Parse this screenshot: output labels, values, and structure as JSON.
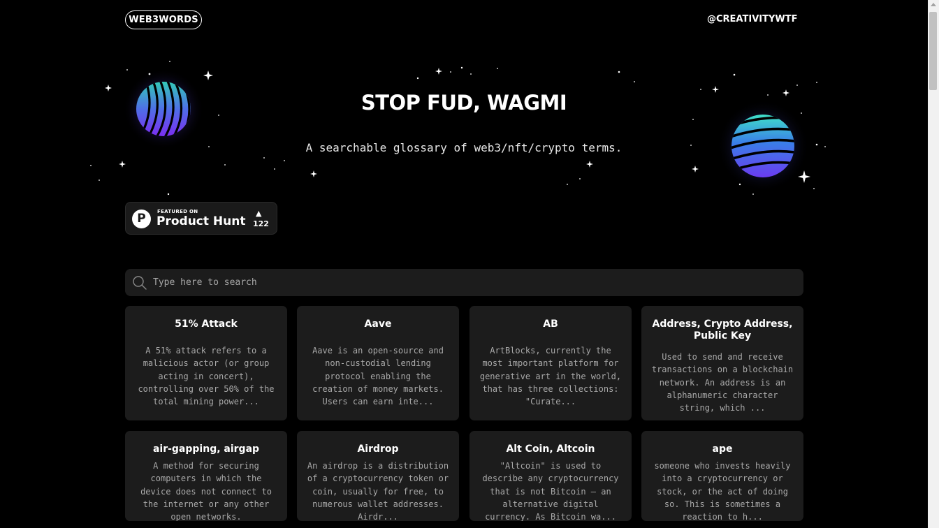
{
  "header": {
    "logo": "WEB3WORDS",
    "handle": "@CREATIVITYWTF"
  },
  "hero": {
    "title": "STOP FUD, WAGMI",
    "subtitle": "A searchable glossary of web3/nft/crypto terms."
  },
  "product_hunt": {
    "featured": "FEATURED ON",
    "name": "Product Hunt",
    "votes": "122",
    "arrow": "▲",
    "logo_letter": "P"
  },
  "search": {
    "placeholder": "Type here to search",
    "value": ""
  },
  "cards": [
    {
      "title": "51% Attack",
      "desc": "A 51% attack refers to a malicious actor (or group acting in concert), controlling over 50% of the total mining power..."
    },
    {
      "title": "Aave",
      "desc": "Aave is an open-source and non-custodial lending protocol enabling the creation of money markets. Users can earn inte..."
    },
    {
      "title": "AB",
      "desc": "ArtBlocks, currently the most important platform for generative art in the world, that has three collections: \"Curate..."
    },
    {
      "title": "Address, Crypto Address, Public Key",
      "desc": "Used to send and receive transactions on a blockchain network. An address is an alphanumeric character string, which ..."
    },
    {
      "title": "air-gapping, airgap",
      "desc": "A method for securing computers in which the device does not connect to the internet or any other open networks."
    },
    {
      "title": "Airdrop",
      "desc": "An airdrop is a distribution of a cryptocurrency token or coin, usually for free, to numerous wallet addresses. Airdr..."
    },
    {
      "title": "Alt Coin, Altcoin",
      "desc": "\"Altcoin\" is used to describe any cryptocurrency that is not Bitcoin — an alternative digital currency. As Bitcoin wa..."
    },
    {
      "title": "ape",
      "desc": "someone who invests heavily into a cryptocurrency or stock, or the act of doing so. This is sometimes a reaction to h..."
    }
  ],
  "colors": {
    "background": "#000000",
    "card": "#1c1c1c",
    "card_text": "#a9a9a9",
    "orb_left_top": "#33c9b8",
    "orb_left_bottom": "#7a2ff0",
    "orb_right_top": "#3fe0c8",
    "orb_right_bottom": "#6a3cf0"
  },
  "icons": {
    "search": "search-icon",
    "product_hunt_logo": "product-hunt-logo-icon",
    "upvote": "upvote-arrow-icon"
  }
}
